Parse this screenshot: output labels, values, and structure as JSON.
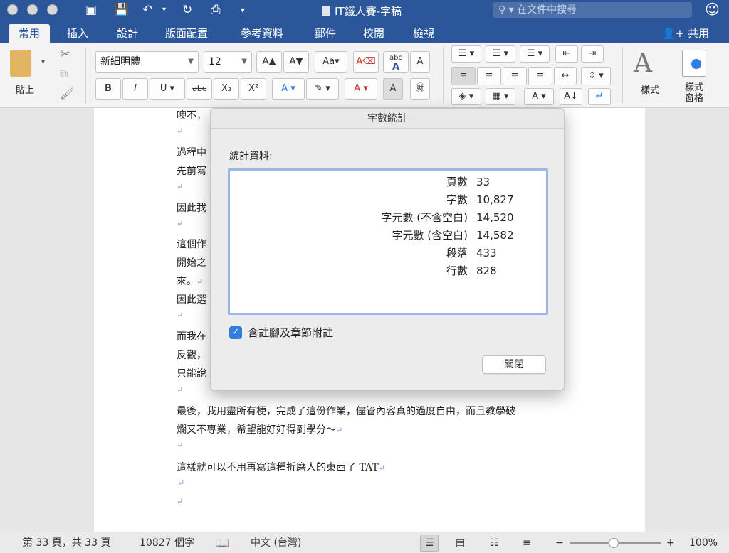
{
  "window": {
    "title": "IT鐵人賽-字稿",
    "search_placeholder": "在文件中搜尋"
  },
  "ribbon_tabs": [
    "常用",
    "插入",
    "設計",
    "版面配置",
    "參考資料",
    "郵件",
    "校閱",
    "檢視"
  ],
  "share_label": "共用",
  "ribbon": {
    "paste_label": "貼上",
    "font_name": "新細明體",
    "font_size": "12",
    "styles_label": "樣式",
    "styles_pane_label_1": "樣式",
    "styles_pane_label_2": "窗格"
  },
  "document_lines": {
    "l1": "噢不，",
    "l2": "過程中",
    "l3": "先前寫",
    "l4": "因此我",
    "l5": "這個作",
    "l6": "開始之",
    "l7": "來。",
    "l8": "因此選",
    "l9": "而我在",
    "l10": "反觀，",
    "l11": "只能說",
    "l12": "最後，我用盡所有梗，完成了這份作業，儘管內容真的過度自由，而且教學破",
    "l13": "爛又不專業，希望能好好得到學分～",
    "l14": "這樣就可以不用再寫這種折磨人的東西了 TAT"
  },
  "dialog": {
    "title": "字數統計",
    "stats_label": "統計資料:",
    "stats": [
      {
        "label": "頁數",
        "value": "33"
      },
      {
        "label": "字數",
        "value": "10,827"
      },
      {
        "label": "字元數 (不含空白)",
        "value": "14,520"
      },
      {
        "label": "字元數 (含空白)",
        "value": "14,582"
      },
      {
        "label": "段落",
        "value": "433"
      },
      {
        "label": "行數",
        "value": "828"
      }
    ],
    "checkbox_label": "含註腳及章節附註",
    "checkbox_checked": true,
    "close_label": "關閉"
  },
  "statusbar": {
    "page_info": "第 33 頁，共 33 頁",
    "word_count": "10827 個字",
    "language": "中文 (台灣)",
    "zoom": "100%"
  },
  "colors": {
    "accent": "#2b579a",
    "checkbox": "#2f7de1"
  }
}
